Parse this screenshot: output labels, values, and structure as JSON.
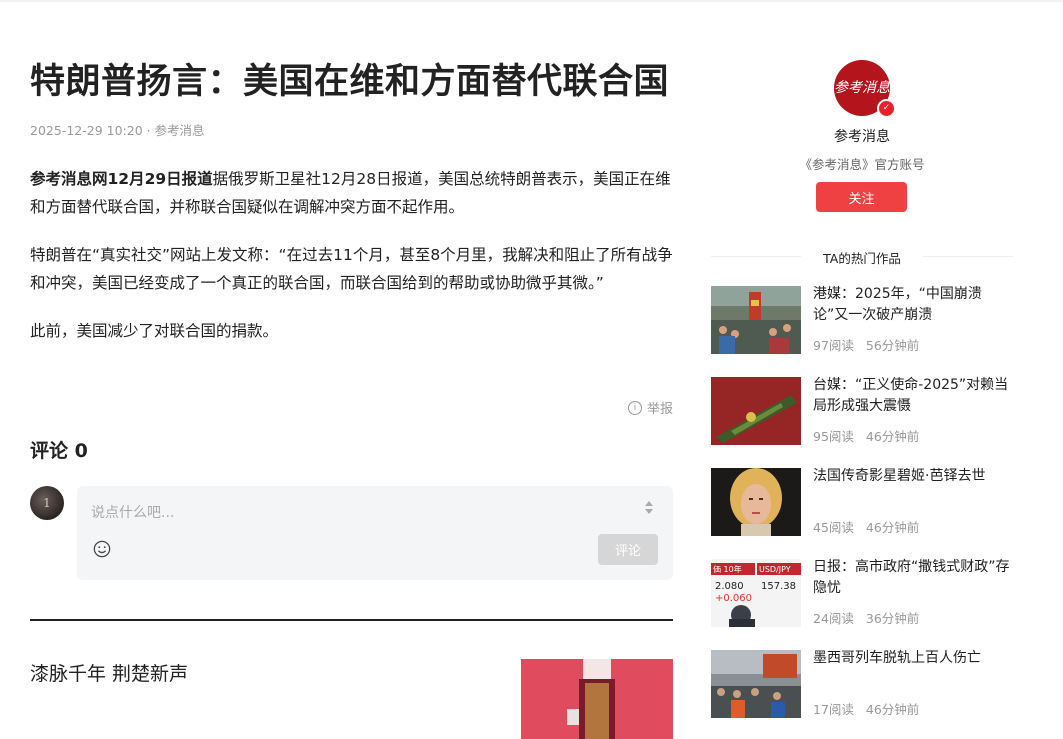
{
  "article": {
    "title": "特朗普扬言：美国在维和方面替代联合国",
    "meta": "2025-12-29 10:20 · 参考消息",
    "paragraphs": [
      {
        "lead": "参考消息网12月29日报道",
        "text": "据俄罗斯卫星社12月28日报道，美国总统特朗普表示，美国正在维和方面替代联合国，并称联合国疑似在调解冲突方面不起作用。"
      },
      {
        "lead": "",
        "text": "特朗普在“真实社交”网站上发文称：“在过去11个月，甚至8个月里，我解决和阻止了所有战争和冲突，美国已经变成了一个真正的联合国，而联合国给到的帮助或协助微乎其微。”"
      },
      {
        "lead": "",
        "text": "此前，美国减少了对联合国的捐款。"
      }
    ],
    "report_label": "举报"
  },
  "comments": {
    "title": "评论 0",
    "placeholder": "说点什么吧...",
    "submit_label": "评论",
    "avatar_text": "1"
  },
  "recommend": {
    "title": "漆脉千年 荆楚新声"
  },
  "sidebar": {
    "logo_text": "参考消息",
    "account_name": "参考消息",
    "account_desc": "《参考消息》官方账号",
    "follow_label": "关注",
    "hot_title": "TA的热门作品",
    "hot_items": [
      {
        "title": "港媒：2025年，“中国崩溃论”又一次破产崩溃",
        "reads": "97阅读",
        "time": "56分钟前"
      },
      {
        "title": "台媒：“正义使命-2025”对赖当局形成强大震慑",
        "reads": "95阅读",
        "time": "46分钟前"
      },
      {
        "title": "法国传奇影星碧姬·芭铎去世",
        "reads": "45阅读",
        "time": "46分钟前"
      },
      {
        "title": "日报：高市政府“撒钱式财政”存隐忧",
        "reads": "24阅读",
        "time": "36分钟前"
      },
      {
        "title": "墨西哥列车脱轨上百人伤亡",
        "reads": "17阅读",
        "time": "46分钟前"
      }
    ],
    "thumb3_texts": [
      "価 10年",
      "USD/JPY",
      "2.080",
      "+0.060",
      "157.38"
    ]
  },
  "colors": {
    "follow_bg": "#f04142",
    "logo_bg": "#b4141c",
    "text_primary": "#222222",
    "text_muted": "#999999"
  }
}
